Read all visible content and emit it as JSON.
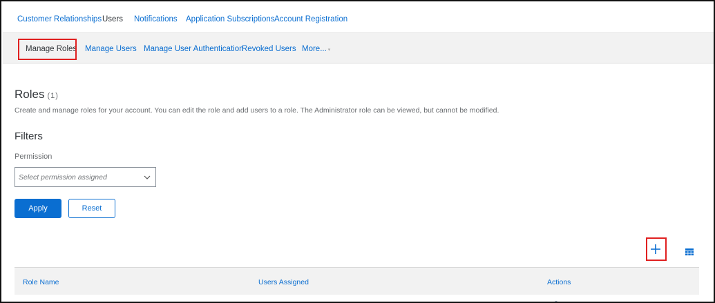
{
  "top_nav": {
    "items": [
      "Customer Relationships",
      "Users",
      "Notifications",
      "Application Subscriptions",
      "Account Registration"
    ],
    "active": "Users"
  },
  "sub_nav": {
    "items": [
      "Manage Roles",
      "Manage Users",
      "Manage User Authentication",
      "Revoked Users",
      "More..."
    ],
    "active": "Manage Roles"
  },
  "roles": {
    "title": "Roles",
    "count": "(1)",
    "description": "Create and manage roles for your account. You can edit the role and add users to a role. The Administrator role can be viewed, but cannot be modified."
  },
  "filters": {
    "title": "Filters",
    "permission_label": "Permission",
    "permission_placeholder": "Select permission assigned",
    "apply_label": "Apply",
    "reset_label": "Reset"
  },
  "toolbar": {
    "add_icon": "plus-icon",
    "settings_icon": "table-settings-icon"
  },
  "table": {
    "columns": [
      "Role Name",
      "Users Assigned",
      "Actions"
    ]
  },
  "colors": {
    "accent": "#0a6ed1",
    "highlight": "#e02020",
    "text": "#32363a",
    "subnav_bg": "#f2f2f2"
  }
}
